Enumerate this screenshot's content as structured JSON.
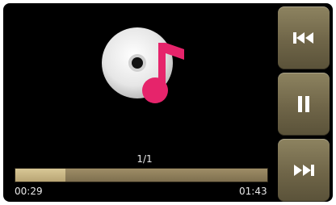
{
  "player": {
    "track_position": "1/1",
    "elapsed": "00:29",
    "total": "01:43",
    "progress_fraction": 0.2,
    "album_art_icon": "music-disc-icon"
  },
  "controls": {
    "previous_icon": "skip-previous-icon",
    "pause_icon": "pause-icon",
    "next_icon": "skip-next-icon"
  },
  "colors": {
    "screen_bg": "#000000",
    "accent_note": "#e6246b",
    "progress_fill": "#d8c796",
    "button_bg": "#7a7052",
    "icon_white": "#ffffff"
  }
}
